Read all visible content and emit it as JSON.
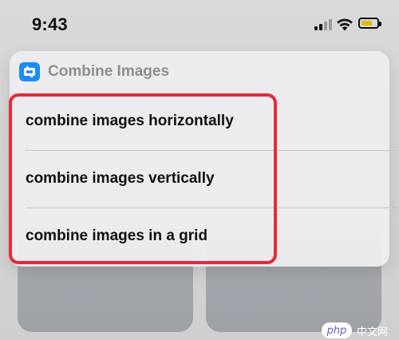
{
  "status_bar": {
    "time": "9:43",
    "signal_icon": "cellular-signal-icon",
    "wifi_icon": "wifi-icon",
    "battery_icon": "battery-icon",
    "battery_level": 0.7,
    "battery_color": "#e2b80e",
    "signal_active_color": "#111111",
    "signal_inactive_color": "#9a9a9a"
  },
  "card": {
    "app_icon": "shortcuts-app-icon",
    "app_icon_color": "#1e8df2",
    "title": "Combine Images",
    "items": [
      {
        "label": "combine images horizontally"
      },
      {
        "label": "combine images vertically"
      },
      {
        "label": "combine images in a grid"
      }
    ]
  },
  "highlight": {
    "color": "#e8283a"
  },
  "watermark": {
    "logo_text": "php",
    "site_text": "中文网"
  }
}
